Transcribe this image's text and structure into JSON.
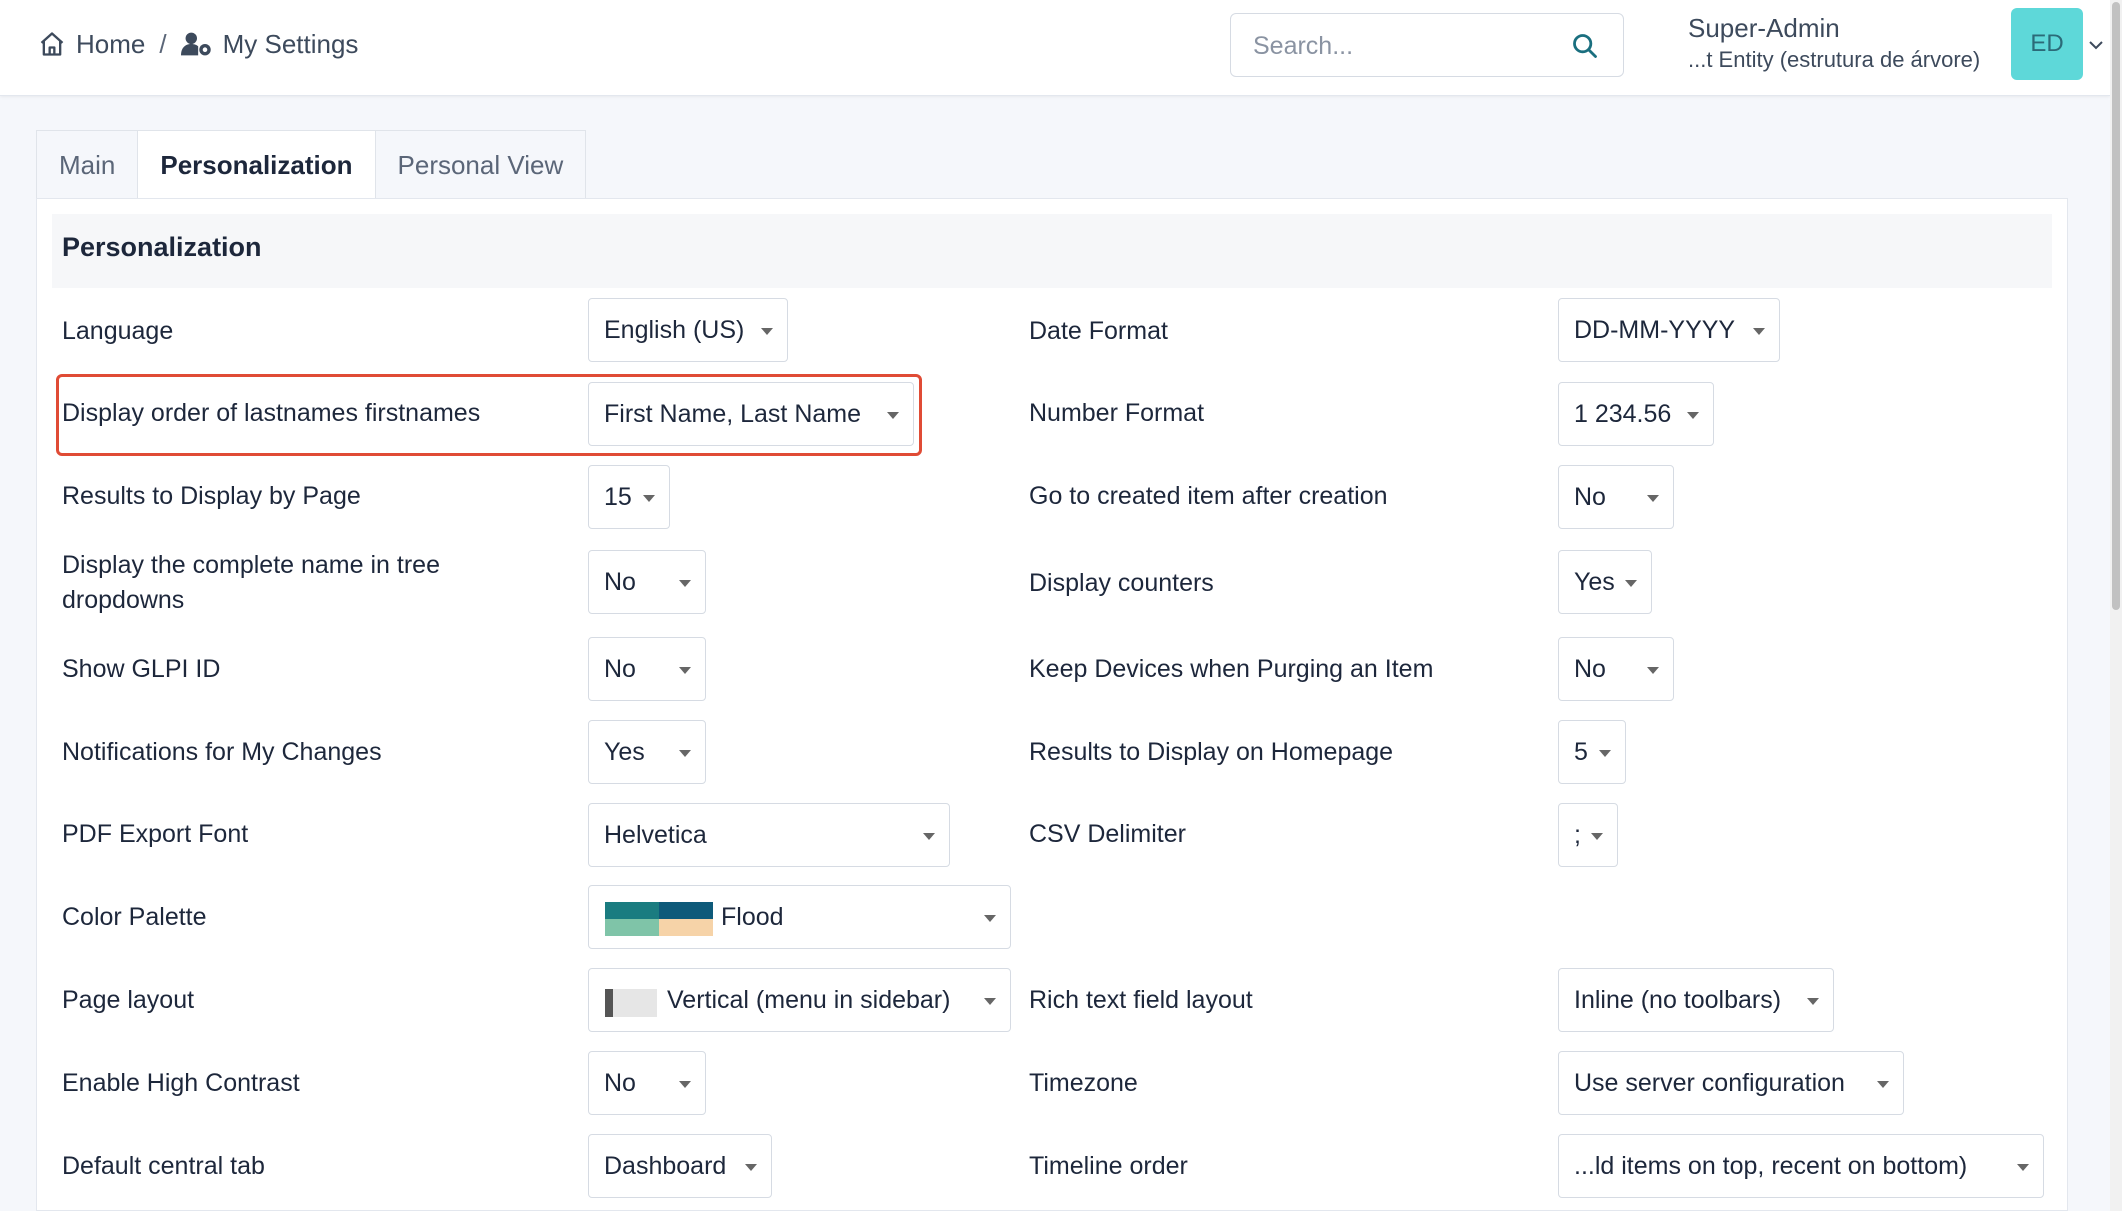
{
  "breadcrumb": {
    "home": "Home",
    "separator": "/",
    "current": "My Settings"
  },
  "search": {
    "placeholder": "Search..."
  },
  "user": {
    "name": "Super-Admin",
    "entity": "...t Entity (estrutura de árvore)",
    "initials": "ED"
  },
  "tabs": [
    {
      "label": "Main"
    },
    {
      "label": "Personalization"
    },
    {
      "label": "Personal View"
    }
  ],
  "section_title": "Personalization",
  "colors": {
    "accent": "#5ed8d9",
    "highlight": "#e04b35"
  },
  "left_fields": [
    {
      "label": "Language",
      "value": "English (US)"
    },
    {
      "label": "Display order of lastnames firstnames",
      "value": "First Name, Last Name"
    },
    {
      "label": "Results to Display by Page",
      "value": "15"
    },
    {
      "label": "Display the complete name in tree dropdowns",
      "value": "No"
    },
    {
      "label": "Show GLPI ID",
      "value": "No"
    },
    {
      "label": "Notifications for My Changes",
      "value": "Yes"
    },
    {
      "label": "PDF Export Font",
      "value": "Helvetica"
    },
    {
      "label": "Color Palette",
      "value": "Flood"
    },
    {
      "label": "Page layout",
      "value": "Vertical (menu in sidebar)"
    },
    {
      "label": "Enable High Contrast",
      "value": "No"
    },
    {
      "label": "Default central tab",
      "value": "Dashboard"
    }
  ],
  "right_fields": [
    {
      "label": "Date Format",
      "value": "DD-MM-YYYY"
    },
    {
      "label": "Number Format",
      "value": "1 234.56"
    },
    {
      "label": "Go to created item after creation",
      "value": "No"
    },
    {
      "label": "Display counters",
      "value": "Yes"
    },
    {
      "label": "Keep Devices when Purging an Item",
      "value": "No"
    },
    {
      "label": "Results to Display on Homepage",
      "value": "5"
    },
    {
      "label": "CSV Delimiter",
      "value": ";"
    },
    {
      "label": "Rich text field layout",
      "value": "Inline (no toolbars)"
    },
    {
      "label": "Timezone",
      "value": "Use server configuration"
    },
    {
      "label": "Timeline order",
      "value": "...ld items on top, recent on bottom)"
    }
  ]
}
